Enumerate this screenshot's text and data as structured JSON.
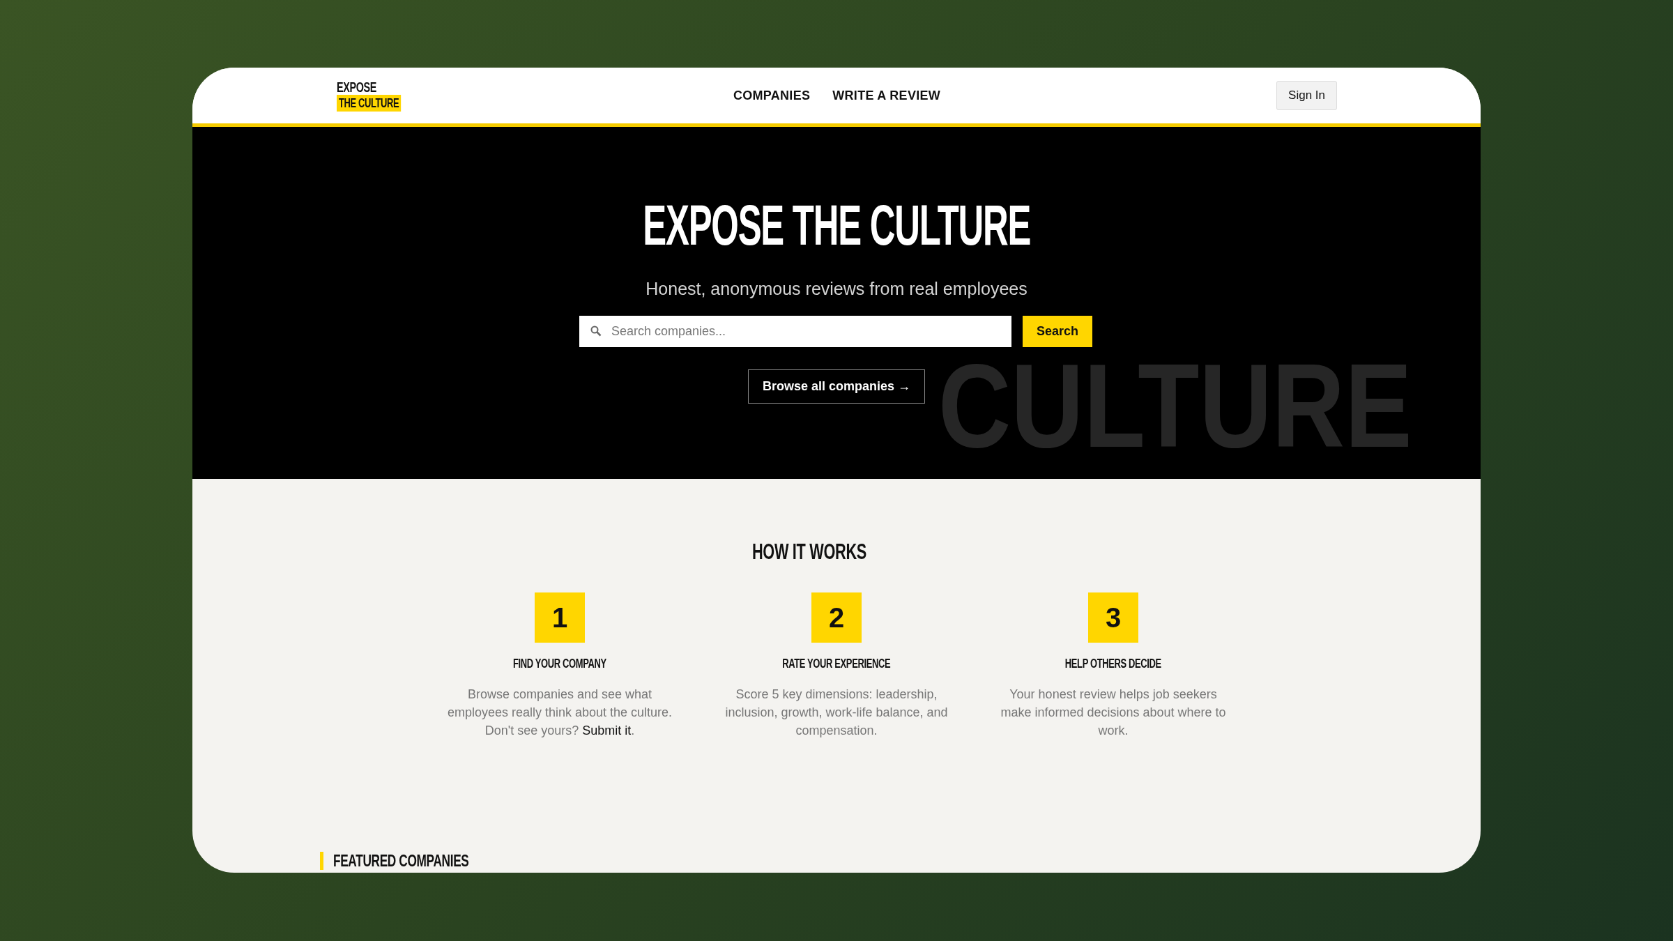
{
  "header": {
    "logo": {
      "line_1": "EXPOSE",
      "line_2": "THE CULTURE"
    },
    "nav": [
      {
        "label": "COMPANIES"
      },
      {
        "label": "WRITE A REVIEW"
      }
    ],
    "sign_in": "Sign In"
  },
  "hero": {
    "title": "EXPOSE THE CULTURE",
    "subtitle": "Honest, anonymous reviews from real employees",
    "search": {
      "placeholder": "Search companies..."
    },
    "search_button": "Search",
    "browse_button": "Browse all companies →",
    "watermark": "CULTURE"
  },
  "how_it_works": {
    "title": "HOW IT WORKS",
    "steps": [
      {
        "number": "1",
        "title": "FIND YOUR COMPANY",
        "text": "Browse companies and see what employees really think about the culture. Don't see yours?",
        "link": "Submit it",
        "after": "."
      },
      {
        "number": "2",
        "title": "RATE YOUR EXPERIENCE",
        "text": "Score 5 key dimensions: leadership, inclusion, growth, work-life balance, and compensation."
      },
      {
        "number": "3",
        "title": "HELP OTHERS DECIDE",
        "text": "Your honest review helps job seekers make informed decisions about where to work."
      }
    ]
  },
  "featured": {
    "title": "FEATURED COMPANIES"
  }
}
